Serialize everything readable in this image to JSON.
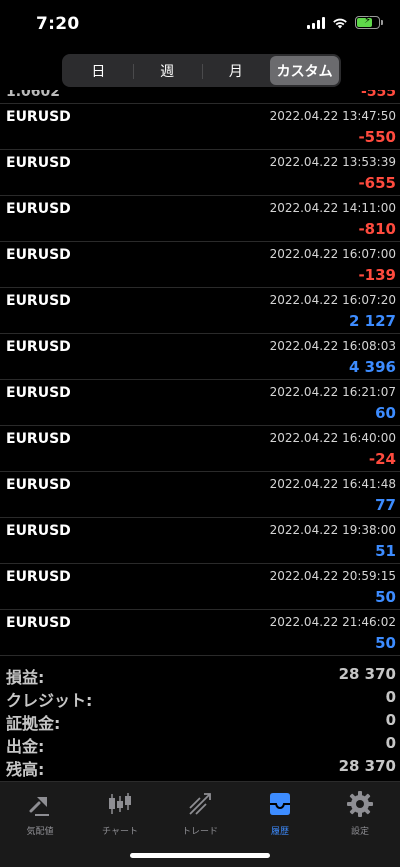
{
  "status": {
    "time": "7:20"
  },
  "period_tabs": [
    {
      "label": "日"
    },
    {
      "label": "週"
    },
    {
      "label": "月"
    },
    {
      "label": "カスタム"
    }
  ],
  "partial_row": {
    "left": "1.0602",
    "right": "-555"
  },
  "deals": [
    {
      "symbol": "EURUSD",
      "time": "2022.04.22 13:47:50",
      "profit": "-550",
      "sign": "neg"
    },
    {
      "symbol": "EURUSD",
      "time": "2022.04.22 13:53:39",
      "profit": "-655",
      "sign": "neg"
    },
    {
      "symbol": "EURUSD",
      "time": "2022.04.22 14:11:00",
      "profit": "-810",
      "sign": "neg"
    },
    {
      "symbol": "EURUSD",
      "time": "2022.04.22 16:07:00",
      "profit": "-139",
      "sign": "neg"
    },
    {
      "symbol": "EURUSD",
      "time": "2022.04.22 16:07:20",
      "profit": "2 127",
      "sign": "pos"
    },
    {
      "symbol": "EURUSD",
      "time": "2022.04.22 16:08:03",
      "profit": "4 396",
      "sign": "pos"
    },
    {
      "symbol": "EURUSD",
      "time": "2022.04.22 16:21:07",
      "profit": "60",
      "sign": "pos"
    },
    {
      "symbol": "EURUSD",
      "time": "2022.04.22 16:40:00",
      "profit": "-24",
      "sign": "neg"
    },
    {
      "symbol": "EURUSD",
      "time": "2022.04.22 16:41:48",
      "profit": "77",
      "sign": "pos"
    },
    {
      "symbol": "EURUSD",
      "time": "2022.04.22 19:38:00",
      "profit": "51",
      "sign": "pos"
    },
    {
      "symbol": "EURUSD",
      "time": "2022.04.22 20:59:15",
      "profit": "50",
      "sign": "pos"
    },
    {
      "symbol": "EURUSD",
      "time": "2022.04.22 21:46:02",
      "profit": "50",
      "sign": "pos"
    }
  ],
  "summary": [
    {
      "label": "損益:",
      "value": "28 370"
    },
    {
      "label": "クレジット:",
      "value": "0"
    },
    {
      "label": "証拠金:",
      "value": "0"
    },
    {
      "label": "出金:",
      "value": "0"
    },
    {
      "label": "残高:",
      "value": "28 370"
    }
  ],
  "tab_bar": [
    {
      "label": "気配値",
      "icon": "quotes-icon"
    },
    {
      "label": "チャート",
      "icon": "candlestick-chart-icon"
    },
    {
      "label": "トレード",
      "icon": "trade-icon"
    },
    {
      "label": "履歴",
      "icon": "history-inbox-icon"
    },
    {
      "label": "設定",
      "icon": "gear-icon"
    }
  ],
  "colors": {
    "negative": "#ff4b3e",
    "positive": "#3d8cff",
    "tab_active": "#3d8cff",
    "tab_inactive": "#8e8e93"
  }
}
